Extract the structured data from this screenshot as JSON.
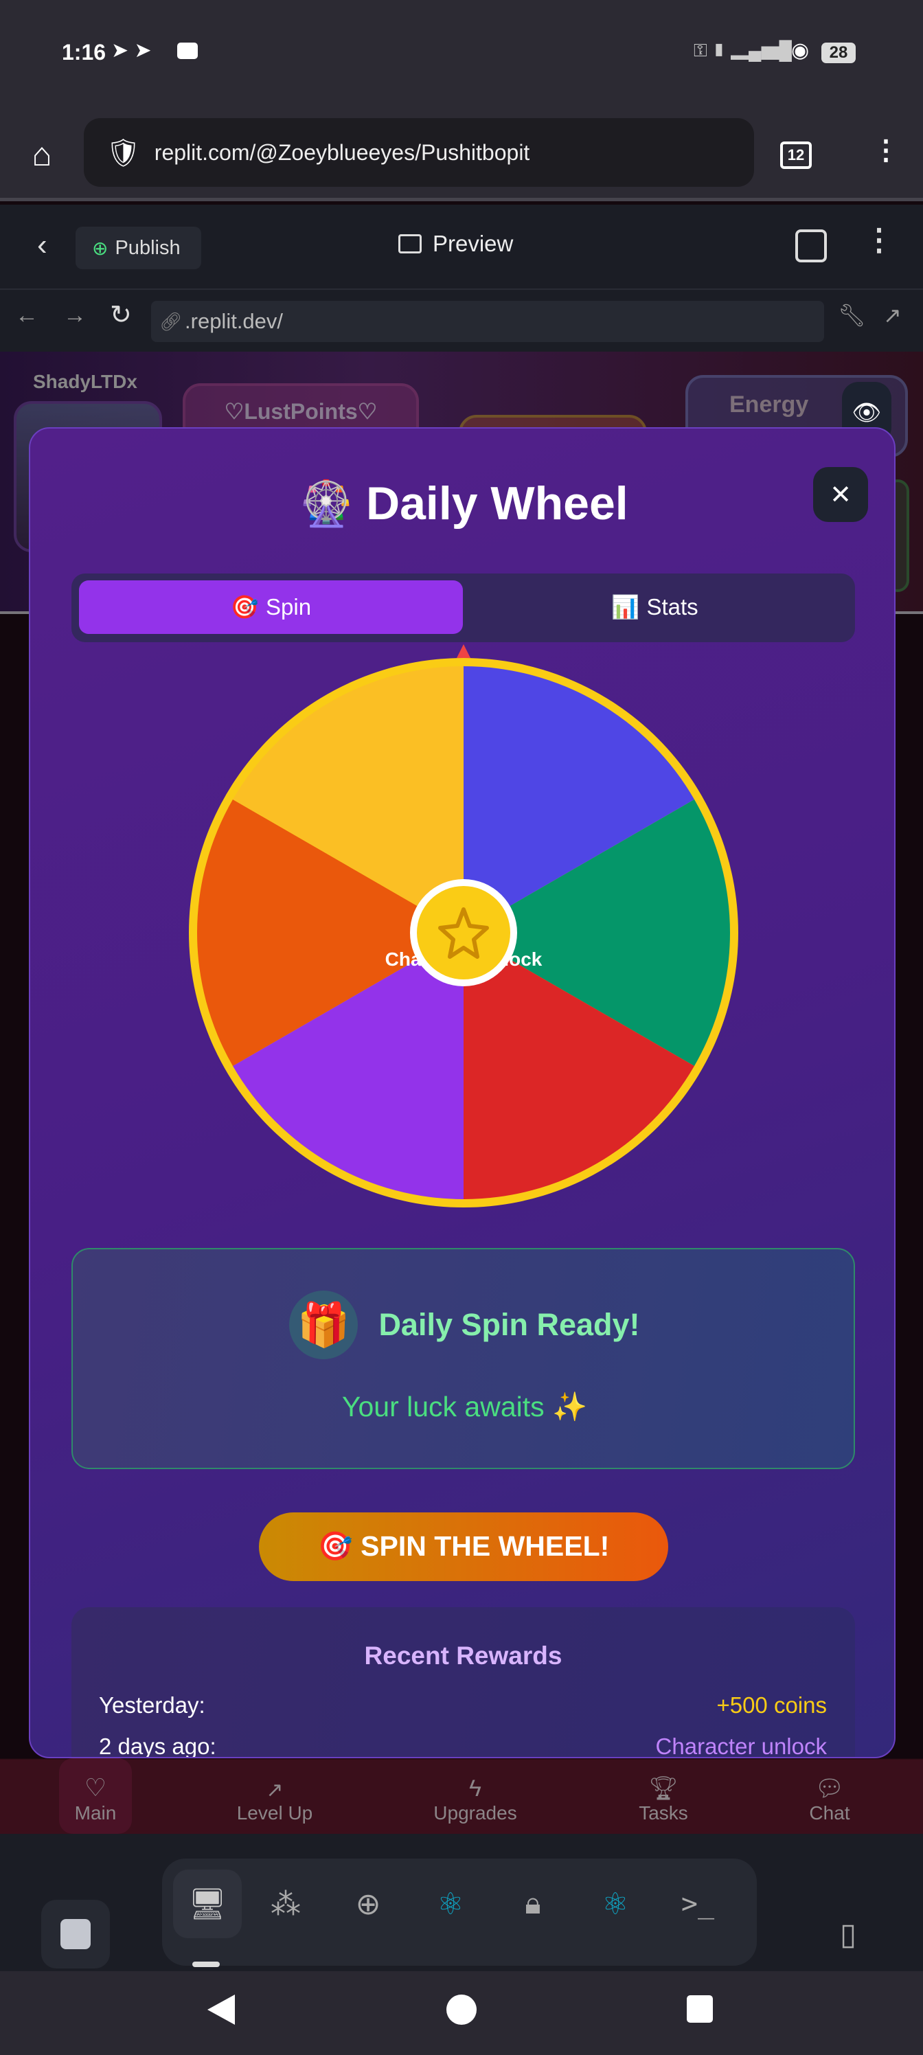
{
  "status": {
    "time": "1:16",
    "battery": "28"
  },
  "browser": {
    "url": "replit.com/@Zoeyblueeyes/Pushitbopit",
    "tab_count": "12"
  },
  "replit": {
    "publish_label": "Publish",
    "preview_label": "Preview",
    "dev_url": ".replit.dev/"
  },
  "background": {
    "username": "ShadyLTDx",
    "lust_points": "♡LustPoints♡",
    "energy": "Energy"
  },
  "modal": {
    "title": "Daily Wheel",
    "title_emoji": "🎡",
    "tabs": [
      {
        "label": "Spin",
        "emoji": "🎯",
        "active": true
      },
      {
        "label": "Stats",
        "emoji": "📊",
        "active": false
      }
    ],
    "wheel": {
      "segment_colors": [
        "#4f46e5",
        "#059669",
        "#dc2626",
        "#9333ea",
        "#ea580c",
        "#fbbf24"
      ],
      "rim_color": "#facc15",
      "hub_color": "#facc15",
      "visible_label": "Character unlock"
    },
    "ready": {
      "emoji": "🎁",
      "title": "Daily Spin Ready!",
      "subtitle": "Your luck awaits ✨"
    },
    "spin_button": "🎯 SPIN THE WHEEL!",
    "recent": {
      "title": "Recent Rewards",
      "rows": [
        {
          "when": "Yesterday:",
          "reward": "+500 coins",
          "color": "#facc15"
        },
        {
          "when": "2 days ago:",
          "reward": "Character unlock",
          "color": "#c084fc"
        }
      ]
    }
  },
  "bottom_nav": [
    {
      "label": "Main",
      "icon": "heart-icon"
    },
    {
      "label": "Level Up",
      "icon": "trend-icon"
    },
    {
      "label": "Upgrades",
      "icon": "bolt-icon"
    },
    {
      "label": "Tasks",
      "icon": "trophy-icon"
    },
    {
      "label": "Chat",
      "icon": "chat-icon"
    }
  ]
}
